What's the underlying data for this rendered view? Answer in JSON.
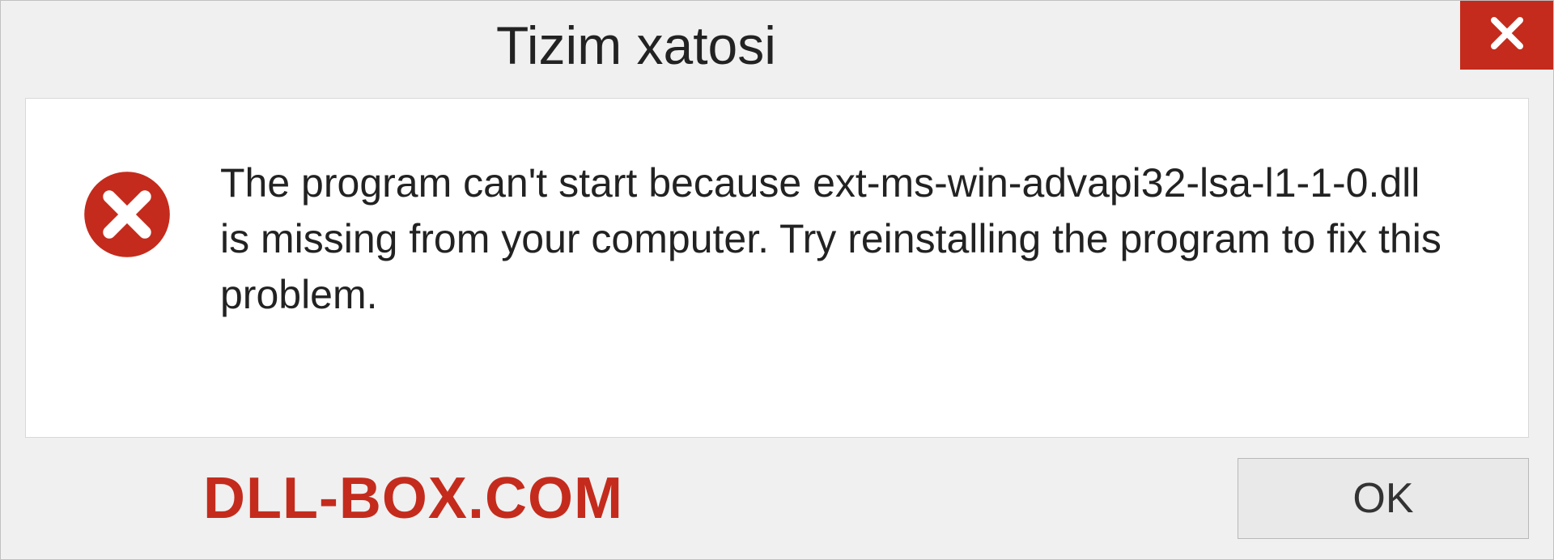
{
  "dialog": {
    "title": "Tizim xatosi",
    "message": "The program can't start because ext-ms-win-advapi32-lsa-l1-1-0.dll is missing from your computer. Try reinstalling the program to fix this problem.",
    "ok_label": "OK"
  },
  "watermark": "DLL-BOX.COM",
  "colors": {
    "error_red": "#c42b1c",
    "dialog_bg": "#f0f0f0",
    "content_bg": "#ffffff"
  }
}
